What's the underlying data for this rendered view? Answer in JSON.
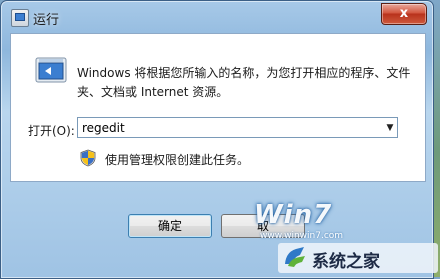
{
  "window": {
    "title": "运行",
    "close_label": "x"
  },
  "dialog": {
    "description": "Windows 将根据您所输入的名称，为您打开相应的程序、文件夹、文档或 Internet 资源。",
    "open_label": "打开(O):",
    "open_value": "regedit",
    "admin_text": "使用管理权限创建此任务。"
  },
  "buttons": {
    "ok": "确定",
    "cancel": "取"
  },
  "watermark": {
    "brand": "Win7",
    "site": "www.winwin7.com",
    "name": "系统之家"
  },
  "colors": {
    "accent": "#3c7fb1",
    "close": "#c8412a",
    "text": "#1a1a1a"
  },
  "icons": [
    "run-icon",
    "close-icon",
    "shield-icon",
    "chevron-down-icon",
    "logo-icon"
  ]
}
